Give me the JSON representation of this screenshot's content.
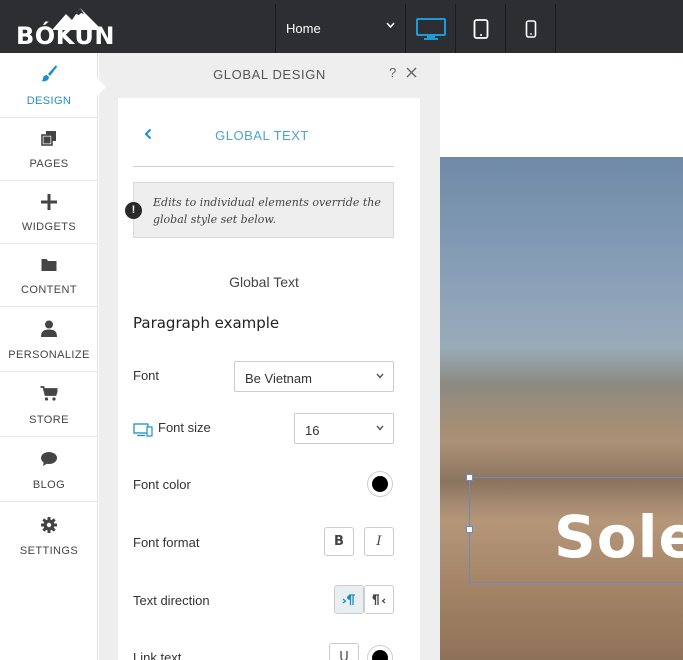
{
  "topbar": {
    "logo_text": "BÓKUN",
    "page_select": {
      "selected": "Home"
    },
    "devices": [
      "desktop",
      "tablet",
      "phone"
    ],
    "active_device": "desktop"
  },
  "sidebar": {
    "items": [
      {
        "label": "DESIGN",
        "icon": "paintbrush-icon",
        "active": true
      },
      {
        "label": "PAGES",
        "icon": "pages-icon"
      },
      {
        "label": "WIDGETS",
        "icon": "plus-icon"
      },
      {
        "label": "CONTENT",
        "icon": "folder-icon"
      },
      {
        "label": "PERSONALIZE",
        "icon": "user-icon"
      },
      {
        "label": "STORE",
        "icon": "cart-icon"
      },
      {
        "label": "BLOG",
        "icon": "speech-bubble-icon"
      },
      {
        "label": "SETTINGS",
        "icon": "gear-icon"
      }
    ]
  },
  "panel": {
    "title": "GLOBAL DESIGN",
    "help": "?",
    "section_title": "GLOBAL TEXT",
    "notice": "Edits to individual elements override the global style set below.",
    "heading": "Global Text",
    "paragraph_example": "Paragraph example",
    "font": {
      "label": "Font",
      "value": "Be Vietnam"
    },
    "font_size": {
      "label": "Font size",
      "value": "16"
    },
    "font_color": {
      "label": "Font color",
      "color": "#000000"
    },
    "font_format": {
      "label": "Font format",
      "bold": "B",
      "italic": "I"
    },
    "text_direction": {
      "label": "Text direction",
      "ltr": "¶",
      "rtl": "¶"
    },
    "link_text": {
      "label": "Link text",
      "underline": "U"
    }
  },
  "preview": {
    "hero_text": "Sole"
  },
  "colors": {
    "accent": "#1e8fc6",
    "topbar": "#2c2e31"
  }
}
